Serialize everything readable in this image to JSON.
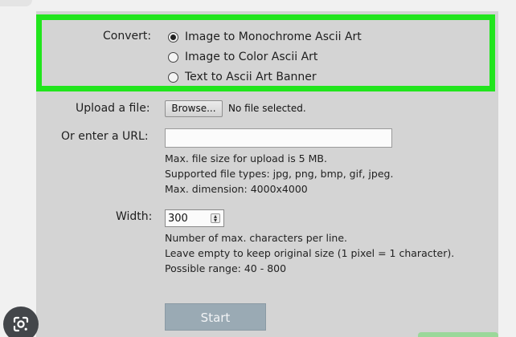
{
  "convert": {
    "label": "Convert:",
    "options": [
      {
        "label": "Image to Monochrome Ascii Art",
        "selected": true
      },
      {
        "label": "Image to Color Ascii Art",
        "selected": false
      },
      {
        "label": "Text to Ascii Art Banner",
        "selected": false
      }
    ],
    "highlight_color": "#21e51d"
  },
  "upload": {
    "label": "Upload a file:",
    "browse_label": "Browse...",
    "status": "No file selected."
  },
  "url": {
    "label": "Or enter a URL:",
    "value": "",
    "info": [
      "Max. file size for upload is 5 MB.",
      "Supported file types: jpg, png, bmp, gif, jpeg.",
      "Max. dimension: 4000x4000"
    ]
  },
  "width": {
    "label": "Width:",
    "value": "300",
    "info": [
      "Number of max. characters per line.",
      "Leave empty to keep original size (1 pixel = 1 character).",
      "Possible range: 40 - 800"
    ]
  },
  "start": {
    "label": "Start"
  },
  "icons": {
    "lens": "google-lens-icon"
  }
}
